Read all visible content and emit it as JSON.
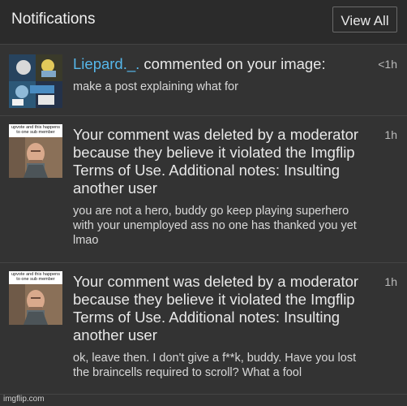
{
  "header": {
    "title": "Notifications",
    "view_all_label": "View All"
  },
  "notifications": [
    {
      "user": "Liepard._.",
      "action": " commented on your image:",
      "message": "make a post explaining what for",
      "time": "<1h"
    },
    {
      "title": "Your comment was deleted by a moderator because they believe it violated the Imgflip Terms of Use. Additional notes: Insulting another user",
      "message": "you are not a hero, buddy go keep playing superhero with your unemployed ass no one has thanked you yet lmao",
      "time": "1h",
      "thumb_caption": "upvote and this happens to one sub member"
    },
    {
      "title": "Your comment was deleted by a moderator because they believe it violated the Imgflip Terms of Use. Additional notes: Insulting another user",
      "message": "ok, leave then. I don't give a f**k, buddy. Have you lost the braincells required to scroll? What a fool",
      "time": "1h",
      "thumb_caption": "upvote and this happens to one sub member"
    }
  ],
  "watermark": "imgflip.com",
  "colors": {
    "background": "#333333",
    "username": "#56b7ea",
    "text": "#e8e8e8"
  }
}
